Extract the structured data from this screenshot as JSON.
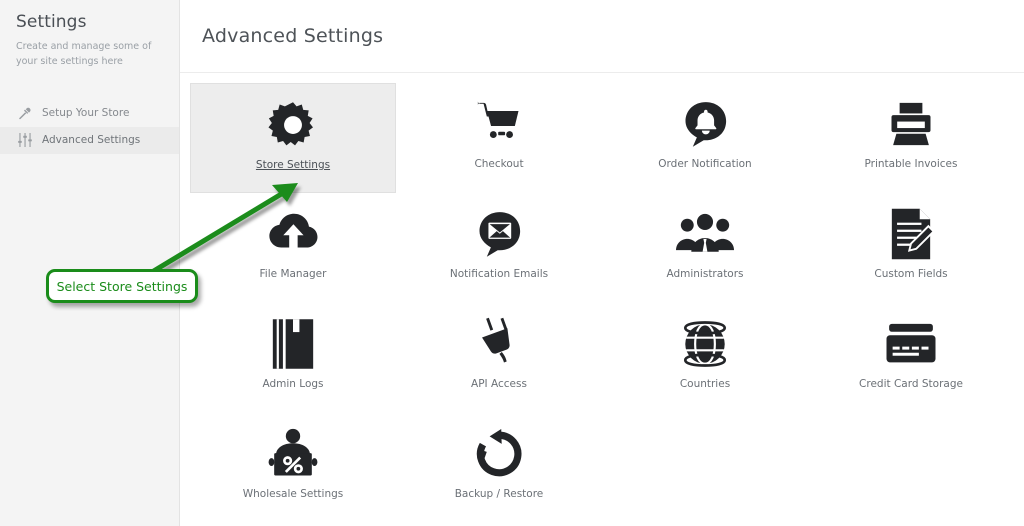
{
  "sidebar": {
    "title": "Settings",
    "subtitle": "Create and manage some of your site settings here",
    "items": [
      {
        "label": "Setup Your Store",
        "icon": "screwdriver-icon",
        "active": false
      },
      {
        "label": "Advanced Settings",
        "icon": "sliders-icon",
        "active": true
      }
    ]
  },
  "header": {
    "title": "Advanced Settings"
  },
  "grid": {
    "tiles": [
      {
        "label": "Store Settings",
        "icon": "gear-icon",
        "selected": true
      },
      {
        "label": "Checkout",
        "icon": "shopping-cart-icon",
        "selected": false
      },
      {
        "label": "Order Notification",
        "icon": "bell-bubble-icon",
        "selected": false
      },
      {
        "label": "Printable Invoices",
        "icon": "printer-icon",
        "selected": false
      },
      {
        "label": "File Manager",
        "icon": "cloud-upload-icon",
        "selected": false
      },
      {
        "label": "Notification Emails",
        "icon": "envelope-bubble-icon",
        "selected": false
      },
      {
        "label": "Administrators",
        "icon": "people-group-icon",
        "selected": false
      },
      {
        "label": "Custom Fields",
        "icon": "document-pencil-icon",
        "selected": false
      },
      {
        "label": "Admin Logs",
        "icon": "books-icon",
        "selected": false
      },
      {
        "label": "API Access",
        "icon": "plug-icon",
        "selected": false
      },
      {
        "label": "Countries",
        "icon": "globe-icon",
        "selected": false
      },
      {
        "label": "Credit Card Storage",
        "icon": "credit-card-icon",
        "selected": false
      },
      {
        "label": "Wholesale Settings",
        "icon": "person-percent-icon",
        "selected": false
      },
      {
        "label": "Backup / Restore",
        "icon": "restore-arrow-icon",
        "selected": false
      }
    ]
  },
  "annotation": {
    "callout_text": "Select Store Settings",
    "color": "#1a8c1a"
  }
}
